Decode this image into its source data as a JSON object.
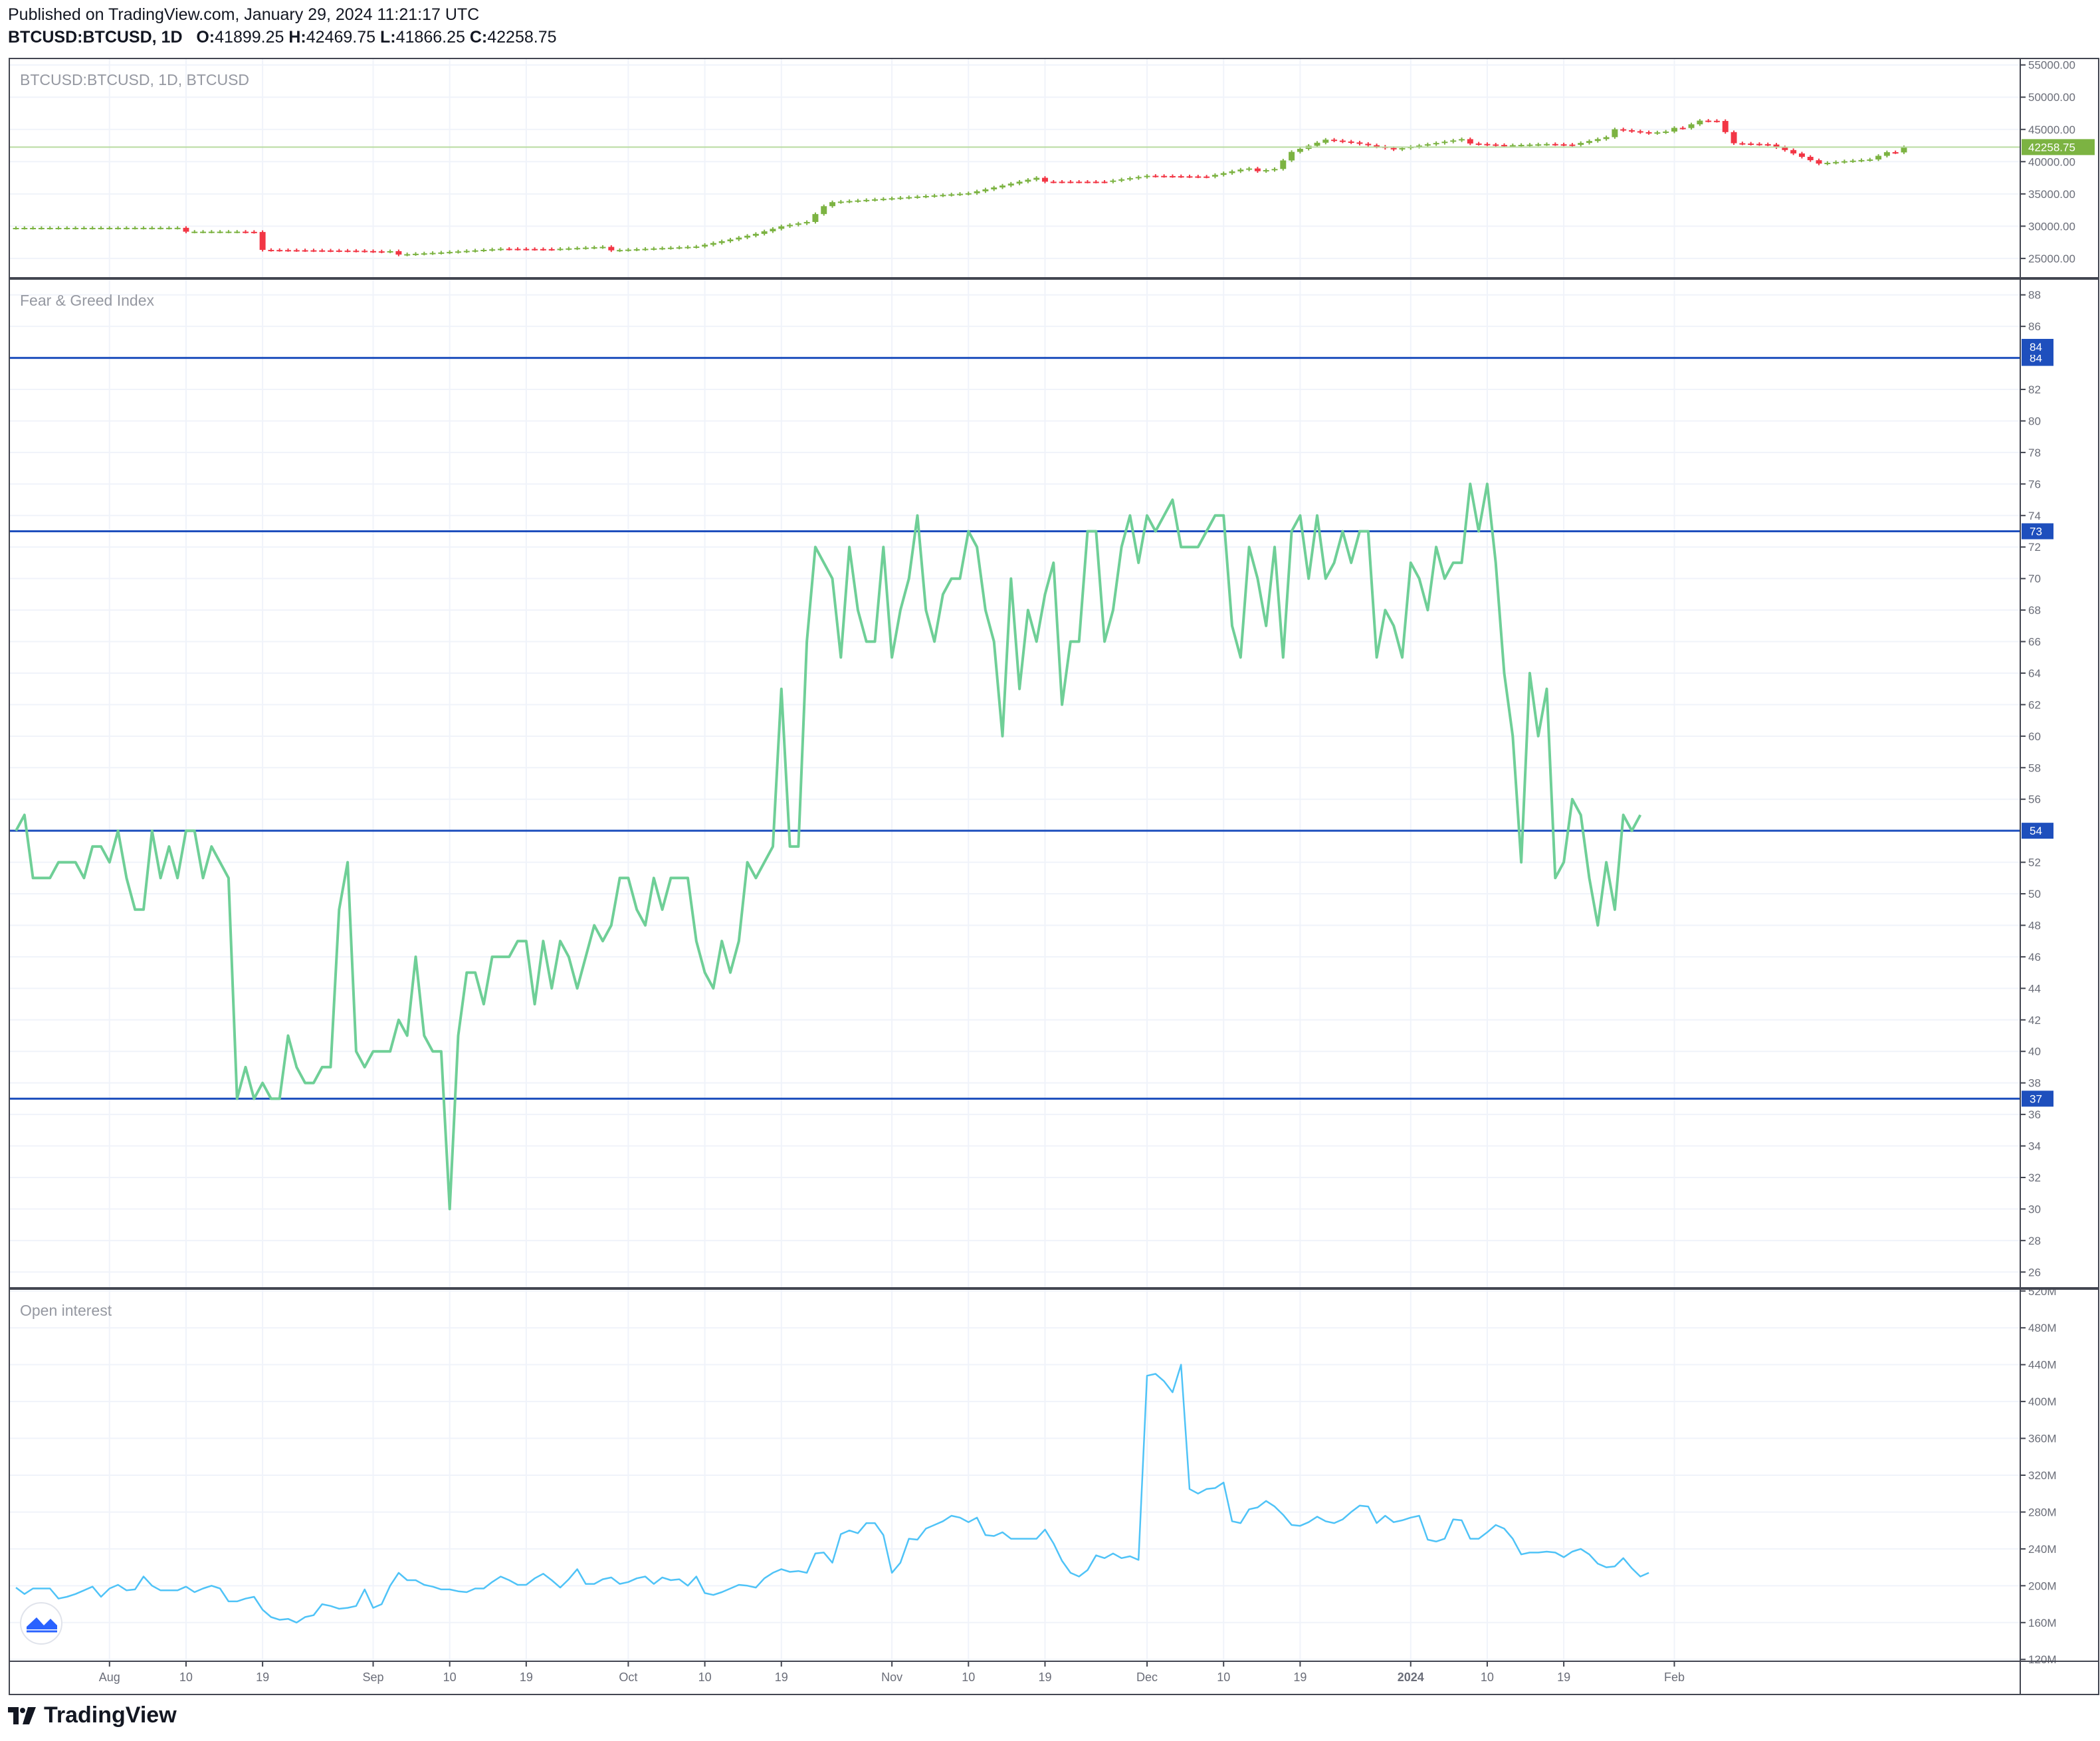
{
  "header": {
    "published": "Published on TradingView.com, January 29, 2024 11:21:17 UTC",
    "symbol": "BTCUSD:BTCUSD, 1D",
    "o_label": "O:",
    "o_value": "41899.25",
    "h_label": "H:",
    "h_value": "42469.75",
    "l_label": "L:",
    "l_value": "41866.25",
    "c_label": "C:",
    "c_value": "42258.75"
  },
  "footer": {
    "brand": "TradingView"
  },
  "colors": {
    "up": "#7cb342",
    "down": "#f23645",
    "fgi": "#6fcf97",
    "oi": "#4fc3f7",
    "hline": "#1e4fbd",
    "grid": "#f0f3fa"
  },
  "chart_data": [
    {
      "type": "candlestick",
      "title": "BTCUSD:BTCUSD, 1D, BTCUSD",
      "ylim": [
        22000,
        56000
      ],
      "y_ticks": [
        "55000.00",
        "50000.00",
        "45000.00",
        "40000.00",
        "35000.00",
        "30000.00",
        "25000.00"
      ],
      "y_tick_values": [
        55000,
        50000,
        45000,
        40000,
        35000,
        30000,
        25000
      ],
      "last_price": "42258.75",
      "anchors": [
        [
          0,
          29900
        ],
        [
          26,
          29300
        ],
        [
          28,
          29200
        ],
        [
          29,
          26400
        ],
        [
          40,
          26000
        ],
        [
          43,
          25800
        ],
        [
          50,
          26100
        ],
        [
          57,
          26500
        ],
        [
          63,
          26300
        ],
        [
          80,
          26900
        ],
        [
          84,
          27900
        ],
        [
          87,
          28700
        ],
        [
          90,
          29800
        ],
        [
          93,
          30400
        ],
        [
          96,
          34000
        ],
        [
          112,
          35000
        ],
        [
          120,
          37200
        ],
        [
          128,
          37000
        ],
        [
          133,
          37800
        ],
        [
          140,
          37500
        ],
        [
          144,
          38500
        ],
        [
          148,
          39100
        ],
        [
          150,
          41700
        ],
        [
          154,
          43500
        ],
        [
          157,
          43000
        ],
        [
          162,
          41800
        ],
        [
          170,
          43200
        ],
        [
          175,
          42700
        ],
        [
          180,
          42800
        ],
        [
          183,
          42600
        ],
        [
          187,
          43700
        ],
        [
          188,
          44900
        ],
        [
          192,
          44200
        ],
        [
          194,
          44400
        ],
        [
          198,
          46600
        ],
        [
          200,
          46500
        ],
        [
          202,
          43000
        ],
        [
          206,
          42700
        ],
        [
          208,
          41800
        ],
        [
          212,
          39600
        ],
        [
          215,
          39900
        ],
        [
          218,
          40100
        ],
        [
          222,
          42258
        ]
      ],
      "x_ticks": [
        {
          "label": "Aug",
          "i": 11
        },
        {
          "label": "10",
          "i": 20
        },
        {
          "label": "19",
          "i": 29
        },
        {
          "label": "Sep",
          "i": 42
        },
        {
          "label": "10",
          "i": 51
        },
        {
          "label": "19",
          "i": 60
        },
        {
          "label": "Oct",
          "i": 72
        },
        {
          "label": "10",
          "i": 81
        },
        {
          "label": "19",
          "i": 90
        },
        {
          "label": "Nov",
          "i": 103
        },
        {
          "label": "10",
          "i": 112
        },
        {
          "label": "19",
          "i": 121
        },
        {
          "label": "Dec",
          "i": 133
        },
        {
          "label": "10",
          "i": 142
        },
        {
          "label": "19",
          "i": 151
        },
        {
          "label": "2024",
          "i": 164
        },
        {
          "label": "10",
          "i": 173
        },
        {
          "label": "19",
          "i": 182
        },
        {
          "label": "Feb",
          "i": 195
        }
      ]
    },
    {
      "type": "line",
      "title": "Fear & Greed Index",
      "ylim": [
        25,
        89
      ],
      "y_ticks": [
        "88",
        "86",
        "82",
        "80",
        "78",
        "76",
        "74",
        "72",
        "70",
        "68",
        "66",
        "64",
        "62",
        "60",
        "58",
        "56",
        "52",
        "50",
        "48",
        "46",
        "44",
        "42",
        "40",
        "38",
        "36",
        "34",
        "32",
        "30",
        "28",
        "26"
      ],
      "y_tick_values": [
        88,
        86,
        82,
        80,
        78,
        76,
        74,
        72,
        70,
        68,
        66,
        64,
        62,
        60,
        58,
        56,
        52,
        50,
        48,
        46,
        44,
        42,
        40,
        38,
        36,
        34,
        32,
        30,
        28,
        26
      ],
      "horizontal_lines": [
        {
          "value": 84,
          "label": "84"
        },
        {
          "value": 73,
          "label": "73"
        },
        {
          "value": 54,
          "label": "54"
        },
        {
          "value": 37,
          "label": "37"
        }
      ],
      "extra_badge": {
        "value": 84.7,
        "label": "84"
      },
      "values": [
        54,
        55,
        51,
        51,
        51,
        52,
        52,
        52,
        51,
        53,
        53,
        52,
        54,
        51,
        49,
        49,
        54,
        51,
        53,
        51,
        54,
        54,
        51,
        53,
        52,
        51,
        37,
        39,
        37,
        38,
        37,
        37,
        41,
        39,
        38,
        38,
        39,
        39,
        49,
        52,
        40,
        39,
        40,
        40,
        40,
        42,
        41,
        46,
        41,
        40,
        40,
        30,
        41,
        45,
        45,
        43,
        46,
        46,
        46,
        47,
        47,
        43,
        47,
        44,
        47,
        46,
        44,
        46,
        48,
        47,
        48,
        51,
        51,
        49,
        48,
        51,
        49,
        51,
        51,
        51,
        47,
        45,
        44,
        47,
        45,
        47,
        52,
        51,
        52,
        53,
        63,
        53,
        53,
        66,
        72,
        71,
        70,
        65,
        72,
        68,
        66,
        66,
        72,
        65,
        68,
        70,
        74,
        68,
        66,
        69,
        70,
        70,
        73,
        72,
        68,
        66,
        60,
        70,
        63,
        68,
        66,
        69,
        71,
        62,
        66,
        66,
        73,
        73,
        66,
        68,
        72,
        74,
        71,
        74,
        73,
        74,
        75,
        72,
        72,
        72,
        73,
        74,
        74,
        67,
        65,
        72,
        70,
        67,
        72,
        65,
        73,
        74,
        70,
        74,
        70,
        71,
        73,
        71,
        73,
        73,
        65,
        68,
        67,
        65,
        71,
        70,
        68,
        72,
        70,
        71,
        71,
        76,
        73,
        76,
        71,
        64,
        60,
        52,
        64,
        60,
        63,
        51,
        52,
        56,
        55,
        51,
        48,
        52,
        49,
        55,
        54,
        55
      ]
    },
    {
      "type": "line",
      "title": "Open interest",
      "ylim": [
        118,
        522
      ],
      "y_ticks": [
        "520M",
        "480M",
        "440M",
        "400M",
        "360M",
        "320M",
        "280M",
        "240M",
        "200M",
        "160M",
        "120M"
      ],
      "y_tick_values": [
        520,
        480,
        440,
        400,
        360,
        320,
        280,
        240,
        200,
        160,
        120
      ],
      "values": [
        198,
        191,
        197,
        197,
        197,
        186,
        188,
        191,
        195,
        199,
        188,
        197,
        201,
        195,
        196,
        210,
        200,
        195,
        195,
        195,
        199,
        193,
        197,
        200,
        197,
        183,
        183,
        186,
        188,
        174,
        166,
        163,
        164,
        160,
        166,
        168,
        180,
        178,
        175,
        176,
        178,
        196,
        176,
        180,
        200,
        214,
        206,
        206,
        201,
        199,
        196,
        196,
        194,
        193,
        197,
        197,
        204,
        210,
        206,
        201,
        201,
        208,
        213,
        206,
        198,
        207,
        218,
        202,
        202,
        207,
        209,
        202,
        204,
        208,
        210,
        202,
        209,
        206,
        207,
        200,
        210,
        192,
        190,
        193,
        197,
        201,
        200,
        198,
        208,
        214,
        218,
        215,
        216,
        214,
        235,
        236,
        225,
        256,
        260,
        257,
        268,
        268,
        255,
        214,
        225,
        251,
        250,
        262,
        266,
        270,
        276,
        274,
        269,
        274,
        255,
        254,
        258,
        251,
        251,
        251,
        251,
        261,
        246,
        227,
        214,
        210,
        217,
        233,
        230,
        235,
        230,
        232,
        228,
        428,
        430,
        422,
        410,
        440,
        305,
        300,
        305,
        306,
        312,
        270,
        268,
        283,
        285,
        292,
        286,
        277,
        266,
        265,
        269,
        275,
        270,
        268,
        272,
        280,
        287,
        286,
        268,
        276,
        269,
        271,
        274,
        276,
        250,
        248,
        251,
        272,
        271,
        251,
        251,
        258,
        266,
        262,
        251,
        234,
        236,
        236,
        237,
        236,
        231,
        237,
        240,
        234,
        224,
        220,
        221,
        230,
        219,
        210,
        214
      ]
    }
  ]
}
